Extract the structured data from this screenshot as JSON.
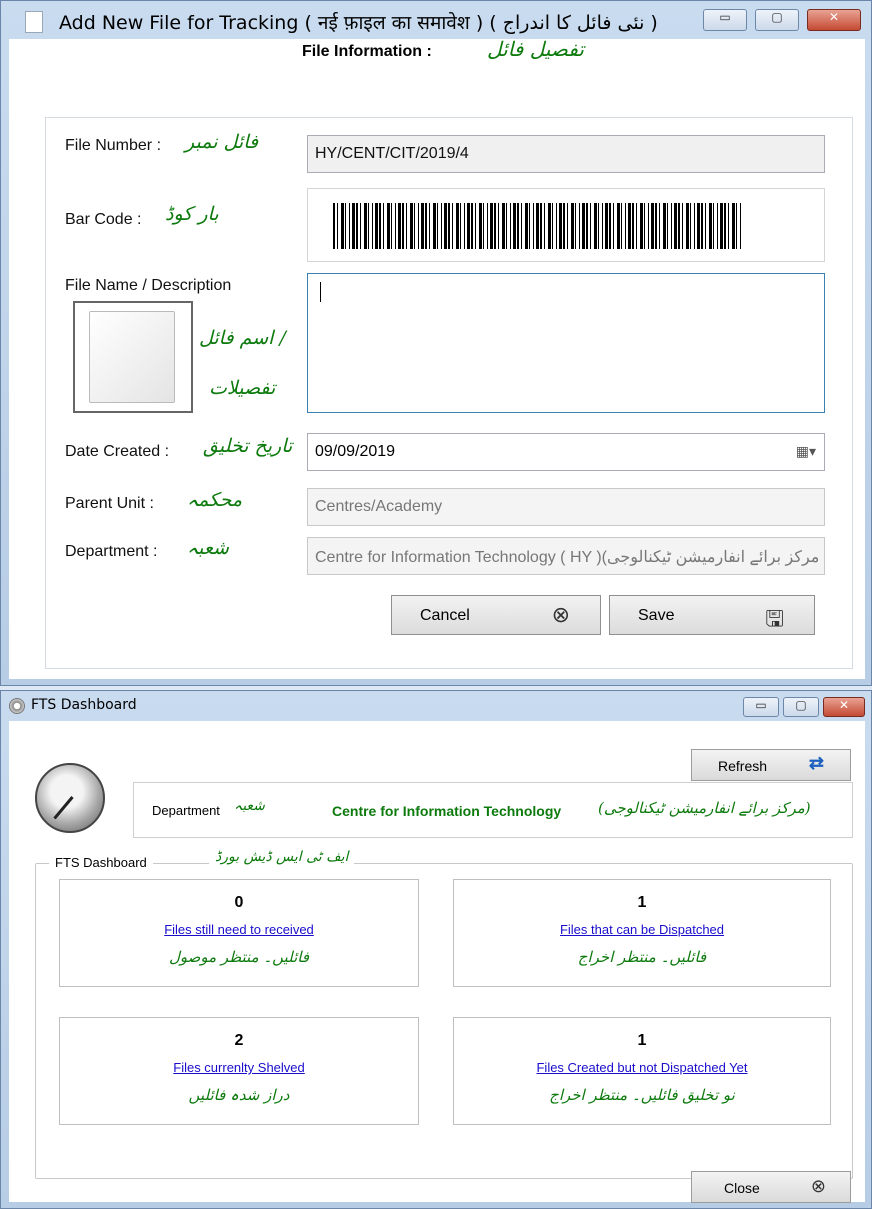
{
  "window1": {
    "title": "Add New File for Tracking ( नई फ़ाइल का समावेश ) ( نئی فائل کا اندراج )",
    "minimize": "▭",
    "maximize": "▢",
    "close": "✕",
    "header_en": "File Information :",
    "header_ur": "تفصیل فائل",
    "file_number_label": "File Number :",
    "file_number_label_ur": "فائل نمبر",
    "file_number_value": "HY/CENT/CIT/2019/4",
    "barcode_label": "Bar Code :",
    "barcode_label_ur": "بار کوڈ",
    "desc_label": "File Name / Description",
    "desc_label_ur1": "اسم فائل /",
    "desc_label_ur2": "تفصیلات",
    "desc_value": "",
    "date_label": "Date Created :",
    "date_label_ur": "تاریخ تخلیق",
    "date_value": "09/09/2019",
    "calendar_icon": "▦▾",
    "parent_label": "Parent Unit :",
    "parent_label_ur": "محکمہ",
    "parent_value": "Centres/Academy",
    "dept_label": "Department :",
    "dept_label_ur": "شعبہ",
    "dept_value": "Centre for Information Technology ( HY )(مرکز برائے انفارمیشن ٹیکنالوجی",
    "cancel_label": "Cancel",
    "cancel_icon": "⊗",
    "save_label": "Save",
    "save_icon": "🖫"
  },
  "window2": {
    "title": "FTS Dashboard",
    "minimize": "▭",
    "maximize": "▢",
    "close": "✕",
    "refresh_label": "Refresh",
    "refresh_icon": "⇄",
    "dept_label": "Department",
    "dept_label_ur": "شعبہ",
    "dept_value": "Centre for Information Technology",
    "dept_value_ur": "(مرکز برائے انفارمیشن ٹیکنالوجی)",
    "legend_en": "FTS Dashboard",
    "legend_ur": "ایف ٹی ایس ڈیش بورڈ",
    "cards": [
      {
        "count": "0",
        "link": "Files still need to received",
        "ur": "فائلیں۔ منتظر موصول"
      },
      {
        "count": "1",
        "link": "Files that can be Dispatched",
        "ur": "فائلیں۔ منتظر اخراج"
      },
      {
        "count": "2",
        "link": "Files currenlty Shelved",
        "ur": "دراز شدہ فائلیں"
      },
      {
        "count": "1",
        "link": "Files Created but not Dispatched Yet",
        "ur": "نو تخلیق فائلیں۔ منتظر اخراج"
      }
    ],
    "close_label": "Close",
    "close_icon": "⊗"
  }
}
